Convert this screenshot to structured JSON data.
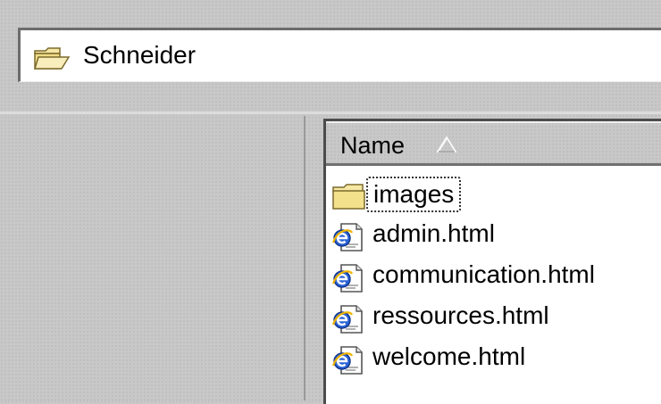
{
  "address_bar": {
    "icon": "folder-open-icon",
    "path": "Schneider"
  },
  "file_list": {
    "column_header": {
      "name_label": "Name",
      "sort_icon": "sort-ascending-icon"
    },
    "items": [
      {
        "name": "images",
        "icon": "folder-icon",
        "selected": true
      },
      {
        "name": "admin.html",
        "icon": "html-document-icon"
      },
      {
        "name": "communication.html",
        "icon": "html-document-icon"
      },
      {
        "name": "ressources.html",
        "icon": "html-document-icon"
      },
      {
        "name": "welcome.html",
        "icon": "html-document-icon"
      }
    ]
  },
  "colors": {
    "folder": "#f4e18c",
    "folder_outline": "#7b6a2c",
    "ie_blue": "#1f54c9"
  }
}
